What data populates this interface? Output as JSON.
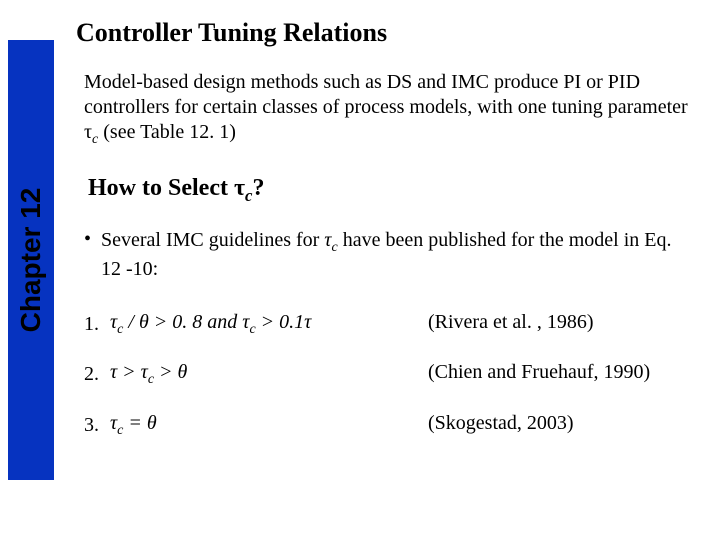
{
  "sidebar": {
    "label": "Chapter 12"
  },
  "title": "Controller Tuning Relations",
  "para": {
    "p1a": "Model-based design methods such as DS and IMC produce PI or PID controllers for certain classes of process models, with one tuning parameter τ",
    "p1b": "c",
    "p1c": " (see Table 12. 1)"
  },
  "subhead": {
    "a": "How to Select τ",
    "b": "c",
    "c": "?"
  },
  "bullet": {
    "dot": "•",
    "t1": "Several IMC guidelines for ",
    "sym": "τ",
    "symsub": "c",
    "t2": " have been published for the model in Eq. 12 -10:"
  },
  "guidelines": [
    {
      "num": "1.",
      "lhs_a": "τ",
      "lhs_b": "c",
      "lhs_c": " / θ  >  0. 8 and ",
      "lhs_d": "τ",
      "lhs_e": "c",
      "lhs_f": " > 0.1τ",
      "ref": "(Rivera et al. , 1986)"
    },
    {
      "num": "2.",
      "lhs_a": "τ > τ",
      "lhs_b": "c",
      "lhs_c": " > θ",
      "lhs_d": "",
      "lhs_e": "",
      "lhs_f": "",
      "ref": "(Chien and Fruehauf, 1990)"
    },
    {
      "num": "3.",
      "lhs_a": "τ",
      "lhs_b": "c",
      "lhs_c": " = θ",
      "lhs_d": "",
      "lhs_e": "",
      "lhs_f": "",
      "ref": "(Skogestad, 2003)"
    }
  ]
}
